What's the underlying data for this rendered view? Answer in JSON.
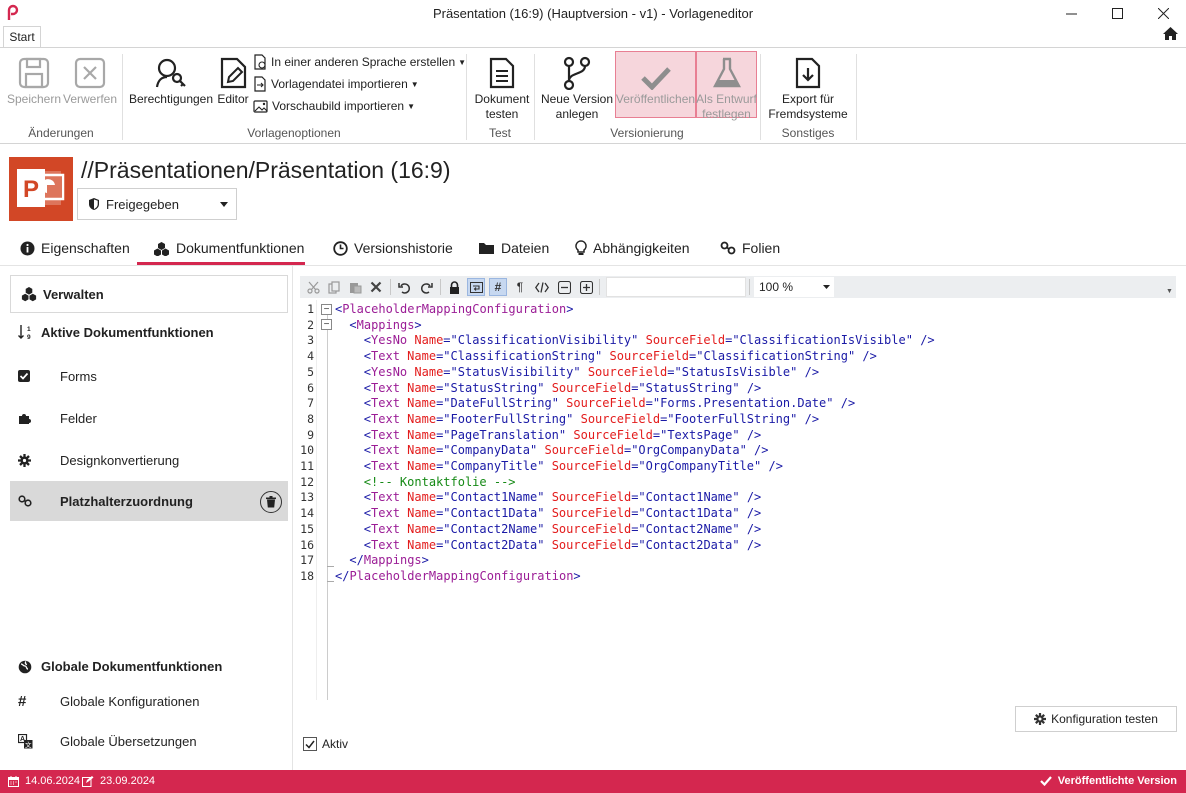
{
  "window": {
    "title": "Präsentation (16:9) (Hauptversion - v1) - Vorlageneditor"
  },
  "ribbon": {
    "tab": "Start",
    "groups": {
      "changes": {
        "label": "Änderungen",
        "save": "Speichern",
        "discard": "Verwerfen"
      },
      "template": {
        "label": "Vorlagenoptionen",
        "permissions": "Berechtigungen",
        "editor": "Editor",
        "other_language": "In einer anderen Sprache erstellen",
        "import_file": "Vorlagendatei importieren",
        "import_preview": "Vorschaubild importieren"
      },
      "test": {
        "label": "Test",
        "test_doc_1": "Dokument",
        "test_doc_2": "testen"
      },
      "versioning": {
        "label": "Versionierung",
        "new_version_1": "Neue Version",
        "new_version_2": "anlegen",
        "publish": "Veröffentlichen",
        "draft_1": "Als Entwurf",
        "draft_2": "festlegen"
      },
      "misc": {
        "label": "Sonstiges",
        "export_1": "Export für",
        "export_2": "Fremdsysteme"
      }
    }
  },
  "header": {
    "path": "//Präsentationen/Präsentation (16:9)",
    "status": "Freigegeben"
  },
  "tabs": [
    "Eigenschaften",
    "Dokumentfunktionen",
    "Versionshistorie",
    "Dateien",
    "Abhängigkeiten",
    "Folien"
  ],
  "left": {
    "manage": "Verwalten",
    "active_heading": "Aktive Dokumentfunktionen",
    "items": [
      "Forms",
      "Felder",
      "Designkonvertierung",
      "Platzhalterzuordnung"
    ],
    "global_heading": "Globale Dokumentfunktionen",
    "global_items": [
      "Globale Konfigurationen",
      "Globale Übersetzungen"
    ]
  },
  "editor": {
    "zoom": "100 %",
    "test_config": "Konfiguration testen",
    "active_label": "Aktiv"
  },
  "code": {
    "root_open": "PlaceholderMappingConfiguration",
    "mappings": "Mappings",
    "comment": "<!-- Kontaktfolie -->",
    "rows": [
      {
        "tag": "YesNo",
        "name": "ClassificationVisibility",
        "field": "ClassificationIsVisible"
      },
      {
        "tag": "Text",
        "name": "ClassificationString",
        "field": "ClassificationString"
      },
      {
        "tag": "YesNo",
        "name": "StatusVisibility",
        "field": "StatusIsVisible"
      },
      {
        "tag": "Text",
        "name": "StatusString",
        "field": "StatusString"
      },
      {
        "tag": "Text",
        "name": "DateFullString",
        "field": "Forms.Presentation.Date"
      },
      {
        "tag": "Text",
        "name": "FooterFullString",
        "field": "FooterFullString"
      },
      {
        "tag": "Text",
        "name": "PageTranslation",
        "field": "TextsPage"
      },
      {
        "tag": "Text",
        "name": "CompanyData",
        "field": "OrgCompanyData"
      },
      {
        "tag": "Text",
        "name": "CompanyTitle",
        "field": "OrgCompanyTitle"
      },
      {
        "tag": "Text",
        "name": "Contact1Name",
        "field": "Contact1Name"
      },
      {
        "tag": "Text",
        "name": "Contact1Data",
        "field": "Contact1Data"
      },
      {
        "tag": "Text",
        "name": "Contact2Name",
        "field": "Contact2Name"
      },
      {
        "tag": "Text",
        "name": "Contact2Data",
        "field": "Contact2Data"
      }
    ]
  },
  "status": {
    "created": "14.06.2024",
    "modified": "23.09.2024",
    "version": "Veröffentlichte Version"
  },
  "colors": {
    "accent": "#d4274f",
    "tag": "#9b1d96",
    "attr": "#e31c1c",
    "value": "#1a1aa6",
    "comment": "#168a16"
  }
}
